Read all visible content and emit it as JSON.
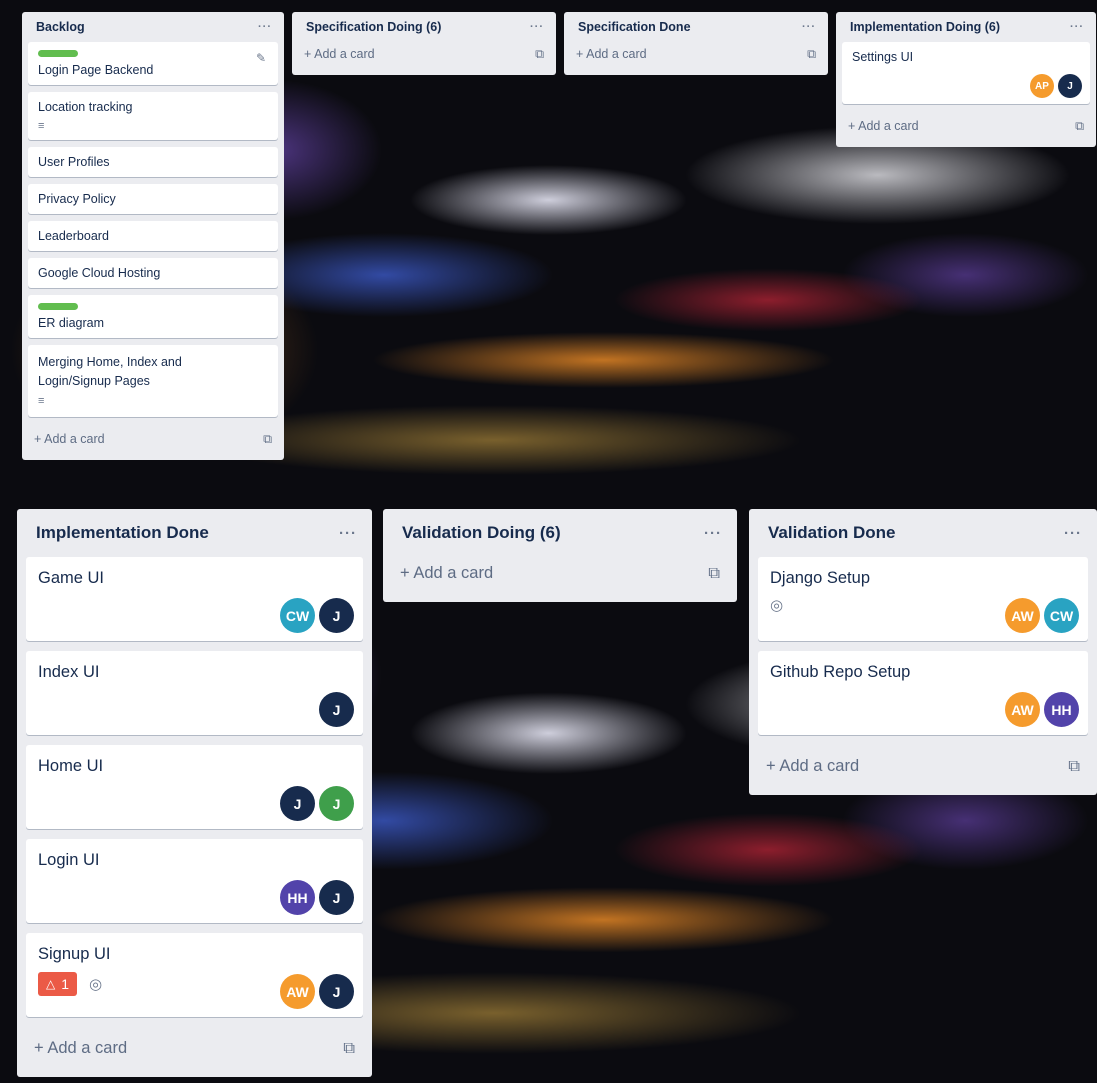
{
  "colors": {
    "list_bg": "#ebecf0",
    "label_green": "#61bd4f",
    "avatar_orange": "#f59b2d",
    "avatar_navy": "#172b4d",
    "avatar_teal": "#29a3c2",
    "avatar_green": "#3f9f4b",
    "avatar_purple": "#5243aa",
    "notification_red": "#eb5a46"
  },
  "icons": {
    "menu": "···",
    "add": "+",
    "template": "⧉",
    "description": "≡",
    "edit": "✎",
    "watch": "◎",
    "bell": "🔔"
  },
  "top_board": {
    "backlog": {
      "title": "Backlog",
      "cards": [
        {
          "title": "Login Page Backend"
        },
        {
          "title": "Location tracking"
        },
        {
          "title": "User Profiles"
        },
        {
          "title": "Privacy Policy"
        },
        {
          "title": "Leaderboard"
        },
        {
          "title": "Google Cloud Hosting"
        },
        {
          "title": "ER diagram"
        },
        {
          "title": "Merging Home, Index and Login/Signup Pages"
        }
      ],
      "add_card": "Add a card"
    },
    "spec_doing": {
      "title": "Specification Doing (6)",
      "add_card": "Add a card"
    },
    "spec_done": {
      "title": "Specification Done",
      "add_card": "Add a card"
    },
    "impl_doing": {
      "title": "Implementation Doing (6)",
      "cards": [
        {
          "title": "Settings UI",
          "members": [
            "AP",
            "J"
          ]
        }
      ],
      "add_card": "Add a card"
    }
  },
  "bottom_board": {
    "impl_done": {
      "title": "Implementation Done",
      "cards": [
        {
          "title": "Game UI",
          "members": [
            "CW",
            "J"
          ]
        },
        {
          "title": "Index UI",
          "members": [
            "J"
          ]
        },
        {
          "title": "Home UI",
          "members": [
            "J",
            "J"
          ]
        },
        {
          "title": "Login UI",
          "members": [
            "HH",
            "J"
          ]
        },
        {
          "title": "Signup UI",
          "members": [
            "AW",
            "J"
          ],
          "notifications": "1"
        }
      ],
      "add_card": "Add a card"
    },
    "val_doing": {
      "title": "Validation Doing (6)",
      "add_card": "Add a card"
    },
    "val_done": {
      "title": "Validation Done",
      "cards": [
        {
          "title": "Django Setup",
          "members": [
            "AW",
            "CW"
          ]
        },
        {
          "title": "Github Repo Setup",
          "members": [
            "AW",
            "HH"
          ]
        }
      ],
      "add_card": "Add a card"
    }
  }
}
